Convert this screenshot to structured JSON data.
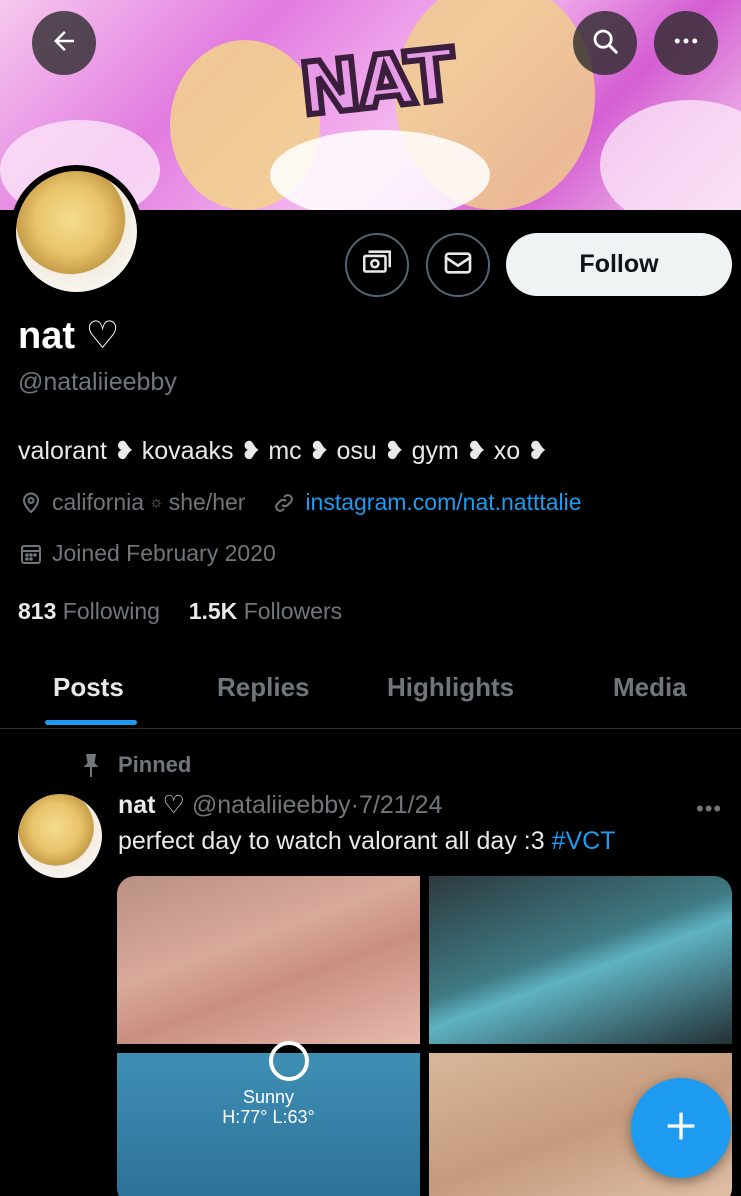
{
  "banner": {
    "title": "NAT"
  },
  "header": {
    "back_icon": "arrow-left-icon",
    "search_icon": "search-icon",
    "more_icon": "more-horizontal-icon"
  },
  "profile": {
    "display_name": "nat ♡",
    "handle": "@nataliieebby",
    "bio": "valorant ❥ kovaaks ❥ mc ❥ osu ❥ gym ❥ xo ❥",
    "location": "california",
    "separator": "☼",
    "pronouns": "she/her",
    "website": "instagram.com/nat.natttalie",
    "joined": "Joined February 2020",
    "following_count": "813",
    "following_label": "Following",
    "followers_count": "1.5K",
    "followers_label": "Followers",
    "follow_label": "Follow"
  },
  "tabs": [
    {
      "label": "Posts",
      "active": true
    },
    {
      "label": "Replies",
      "active": false
    },
    {
      "label": "Highlights",
      "active": false
    },
    {
      "label": "Media",
      "active": false
    }
  ],
  "post": {
    "pinned_label": "Pinned",
    "name": "nat ♡",
    "handle": "@nataliieebby",
    "date_sep": "·",
    "date": "7/21/24",
    "more": "•••",
    "text": "perfect day to watch valorant all day :3 ",
    "hashtag": "#VCT",
    "weather": {
      "condition": "Sunny",
      "range": "H:77°  L:63°"
    }
  },
  "colors": {
    "background": "#000000",
    "accent": "#1d9bf0",
    "muted": "#71767b",
    "text": "#e7e9ea"
  }
}
